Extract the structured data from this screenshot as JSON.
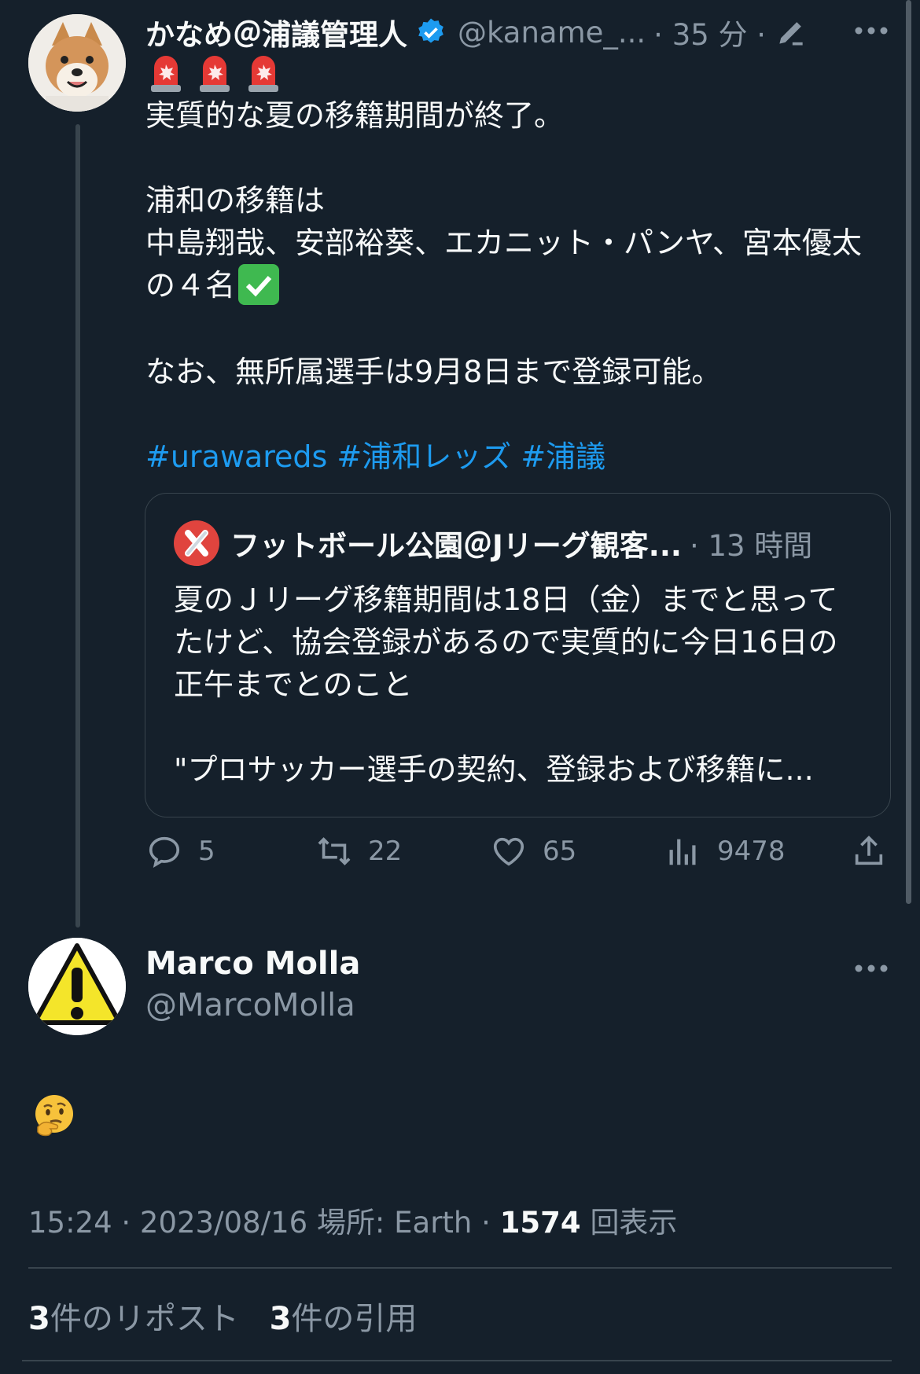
{
  "tweet": {
    "author_name": "かなめ＠浦議管理人",
    "handle": "@kaname_...",
    "time_sep": "· 35 分 ·",
    "line1": "実質的な夏の移籍期間が終了。",
    "line2": "浦和の移籍は",
    "line3": "中島翔哉、安部裕葵、エカニット・パンヤ、宮本優太",
    "line4": "の４名",
    "line5": "なお、無所属選手は9月8日まで登録可能。",
    "hashtag1": "#urawareds",
    "hashtag2": "#浦和レッズ",
    "hashtag3": "#浦議",
    "icons": [
      "siren-emoji",
      "check-mark-emoji",
      "verified-badge",
      "edit-icon",
      "more-icon"
    ]
  },
  "quote": {
    "author_name": "フットボール公園＠Jリーグ観客...",
    "time": "· 13 時間",
    "line1": "夏のＪリーグ移籍期間は18日（金）までと思って",
    "line2": "たけど、協会登録があるので実質的に今日16日の",
    "line3": "正午までとのこと",
    "line4": "\"プロサッカー選手の契約、登録および移籍に..."
  },
  "actions": {
    "replies": "5",
    "reposts": "22",
    "likes": "65",
    "views": "9478"
  },
  "reply": {
    "name": "Marco Molla",
    "handle": "@MarcoMolla",
    "emoji": "thinking-face"
  },
  "meta": {
    "time_date": "15:24 · 2023/08/16",
    "location": "場所: Earth ·",
    "views_count": "1574",
    "views_label": "回表示"
  },
  "stats": {
    "reposts_count": "3",
    "reposts_label": "件のリポスト",
    "quotes_count": "3",
    "quotes_label": "件の引用"
  }
}
